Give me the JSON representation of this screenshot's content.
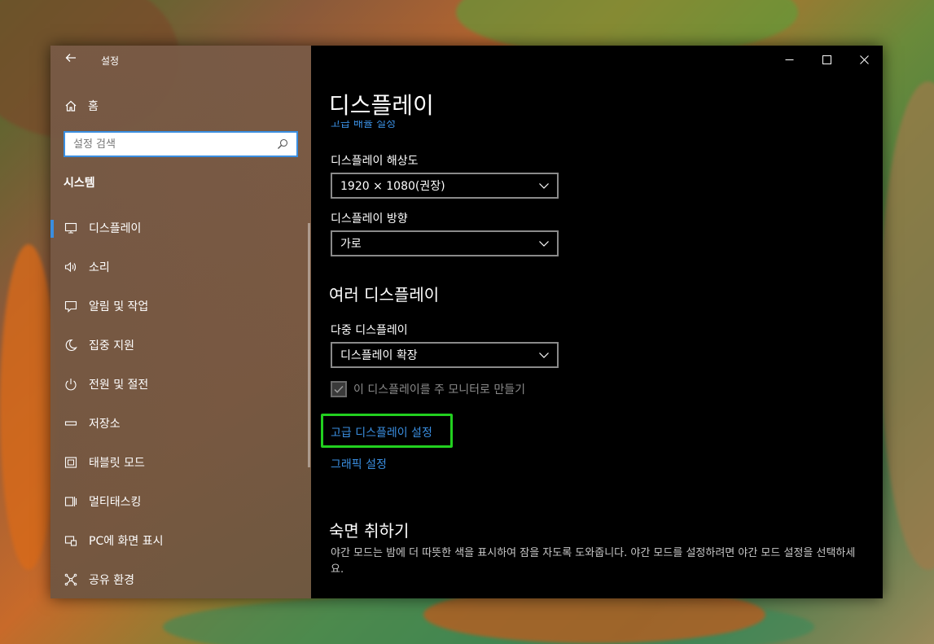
{
  "window": {
    "title": "설정",
    "controls": {
      "minimize": "─",
      "maximize": "☐",
      "close": "✕"
    }
  },
  "sidebar": {
    "home_label": "홈",
    "search_placeholder": "설정 검색",
    "section_label": "시스템",
    "items": [
      {
        "label": "디스플레이",
        "icon": "monitor-icon",
        "active": true
      },
      {
        "label": "소리",
        "icon": "speaker-icon",
        "active": false
      },
      {
        "label": "알림 및 작업",
        "icon": "notification-icon",
        "active": false
      },
      {
        "label": "집중 지원",
        "icon": "moon-icon",
        "active": false
      },
      {
        "label": "전원 및 절전",
        "icon": "power-icon",
        "active": false
      },
      {
        "label": "저장소",
        "icon": "storage-icon",
        "active": false
      },
      {
        "label": "태블릿 모드",
        "icon": "tablet-icon",
        "active": false
      },
      {
        "label": "멀티태스킹",
        "icon": "multitasking-icon",
        "active": false
      },
      {
        "label": "PC에 화면 표시",
        "icon": "project-icon",
        "active": false
      },
      {
        "label": "공유 환경",
        "icon": "share-icon",
        "active": false
      }
    ]
  },
  "main": {
    "title": "디스플레이",
    "clipped_link": "고급 배율 설정",
    "resolution": {
      "label": "디스플레이 해상도",
      "value": "1920 × 1080(권장)"
    },
    "orientation": {
      "label": "디스플레이 방향",
      "value": "가로"
    },
    "multiple_heading": "여러 디스플레이",
    "multiple": {
      "label": "다중 디스플레이",
      "value": "디스플레이 확장"
    },
    "main_monitor_checkbox": {
      "label": "이 디스플레이를 주 모니터로 만들기",
      "checked": true
    },
    "advanced_link": "고급 디스플레이 설정",
    "graphics_link": "그래픽 설정",
    "sleep_heading": "숙면 취하기",
    "sleep_desc": "야간 모드는 밤에 더 따뜻한 색을 표시하여 잠을 자도록 도와줍니다. 야간 모드를 설정하려면 야간 모드 설정을 선택하세요."
  },
  "colors": {
    "accent": "#3a8ee0",
    "highlight": "#22d01f",
    "main_bg": "#000000"
  }
}
